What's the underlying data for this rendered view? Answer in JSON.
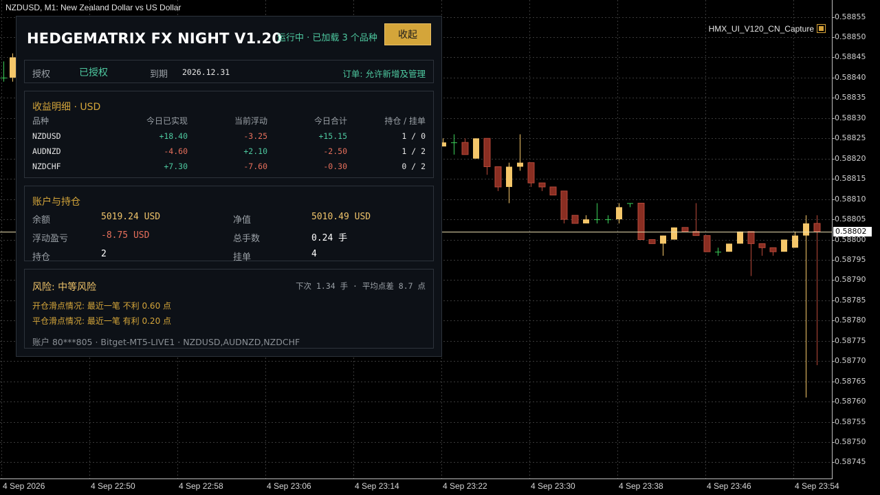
{
  "chart": {
    "title": "NZDUSD, M1:  New Zealand Dollar vs US Dollar",
    "capture_label": "HMX_UI_V120_CN_Capture",
    "current_price": "0.58802",
    "price_labels": [
      "0.58855",
      "0.58850",
      "0.58845",
      "0.58840",
      "0.58835",
      "0.58830",
      "0.58825",
      "0.58820",
      "0.58815",
      "0.58810",
      "0.58805",
      "0.58800",
      "0.58795",
      "0.58790",
      "0.58785",
      "0.58780",
      "0.58775",
      "0.58770",
      "0.58765",
      "0.58760",
      "0.58755",
      "0.58750",
      "0.58745"
    ],
    "time_labels": [
      "4 Sep 2026",
      "4 Sep 22:50",
      "4 Sep 22:58",
      "4 Sep 23:06",
      "4 Sep 23:14",
      "4 Sep 23:22",
      "4 Sep 23:30",
      "4 Sep 23:38",
      "4 Sep 23:46",
      "4 Sep 23:54"
    ],
    "colors": {
      "bull": "#f5c76a",
      "bear": "#8a2e22",
      "bear_wick": "#b8493a",
      "doji": "#3cd15a",
      "grid": "#3a3a3a",
      "current_line": "#e8dcb0"
    }
  },
  "chart_data": {
    "type": "candlestick",
    "ylim": [
      0.58741,
      0.58859
    ],
    "candles": [
      {
        "o": 0.5884,
        "h": 0.58844,
        "l": 0.58839,
        "c": 0.5884
      },
      {
        "o": 0.5884,
        "h": 0.58846,
        "l": 0.58839,
        "c": 0.58845
      },
      {
        "o": 0.58823,
        "h": 0.58825,
        "l": 0.58823,
        "c": 0.58824
      },
      {
        "o": 0.58824,
        "h": 0.58826,
        "l": 0.58821,
        "c": 0.58824
      },
      {
        "o": 0.58824,
        "h": 0.58825,
        "l": 0.58821,
        "c": 0.58821
      },
      {
        "o": 0.5882,
        "h": 0.58825,
        "l": 0.5882,
        "c": 0.58825
      },
      {
        "o": 0.58825,
        "h": 0.58825,
        "l": 0.58816,
        "c": 0.58818
      },
      {
        "o": 0.58818,
        "h": 0.58818,
        "l": 0.58812,
        "c": 0.58813
      },
      {
        "o": 0.58813,
        "h": 0.58819,
        "l": 0.58809,
        "c": 0.58818
      },
      {
        "o": 0.58818,
        "h": 0.58826,
        "l": 0.58817,
        "c": 0.58819
      },
      {
        "o": 0.58819,
        "h": 0.58819,
        "l": 0.58813,
        "c": 0.58814
      },
      {
        "o": 0.58814,
        "h": 0.58814,
        "l": 0.58812,
        "c": 0.58813
      },
      {
        "o": 0.58813,
        "h": 0.58813,
        "l": 0.58811,
        "c": 0.58811
      },
      {
        "o": 0.58812,
        "h": 0.58812,
        "l": 0.58804,
        "c": 0.58805
      },
      {
        "o": 0.58806,
        "h": 0.58806,
        "l": 0.58804,
        "c": 0.58804
      },
      {
        "o": 0.58804,
        "h": 0.58806,
        "l": 0.58804,
        "c": 0.58805
      },
      {
        "o": 0.58805,
        "h": 0.58809,
        "l": 0.58804,
        "c": 0.58805
      },
      {
        "o": 0.58805,
        "h": 0.58806,
        "l": 0.58804,
        "c": 0.58805
      },
      {
        "o": 0.58805,
        "h": 0.58809,
        "l": 0.58804,
        "c": 0.58808
      },
      {
        "o": 0.58809,
        "h": 0.58809,
        "l": 0.58808,
        "c": 0.58809
      },
      {
        "o": 0.58809,
        "h": 0.58809,
        "l": 0.588,
        "c": 0.588
      },
      {
        "o": 0.588,
        "h": 0.588,
        "l": 0.58799,
        "c": 0.58799
      },
      {
        "o": 0.58799,
        "h": 0.58801,
        "l": 0.58796,
        "c": 0.58801
      },
      {
        "o": 0.588,
        "h": 0.58803,
        "l": 0.588,
        "c": 0.58803
      },
      {
        "o": 0.58803,
        "h": 0.58803,
        "l": 0.58802,
        "c": 0.58802
      },
      {
        "o": 0.58802,
        "h": 0.58809,
        "l": 0.58801,
        "c": 0.58801
      },
      {
        "o": 0.58801,
        "h": 0.58801,
        "l": 0.58797,
        "c": 0.58797
      },
      {
        "o": 0.58797,
        "h": 0.58798,
        "l": 0.58796,
        "c": 0.58797
      },
      {
        "o": 0.58797,
        "h": 0.58799,
        "l": 0.58797,
        "c": 0.58799
      },
      {
        "o": 0.58799,
        "h": 0.58802,
        "l": 0.58799,
        "c": 0.58802
      },
      {
        "o": 0.58802,
        "h": 0.58802,
        "l": 0.58791,
        "c": 0.58799
      },
      {
        "o": 0.58799,
        "h": 0.58799,
        "l": 0.58796,
        "c": 0.58798
      },
      {
        "o": 0.58798,
        "h": 0.58798,
        "l": 0.58796,
        "c": 0.58797
      },
      {
        "o": 0.58797,
        "h": 0.588,
        "l": 0.58797,
        "c": 0.588
      },
      {
        "o": 0.58798,
        "h": 0.58802,
        "l": 0.58798,
        "c": 0.58801
      },
      {
        "o": 0.58801,
        "h": 0.58806,
        "l": 0.58761,
        "c": 0.58804
      },
      {
        "o": 0.58804,
        "h": 0.58806,
        "l": 0.58769,
        "c": 0.58802
      }
    ]
  },
  "panel": {
    "title": "HEDGEMATRIX FX NIGHT V1.20",
    "status": "运行中 · 已加载 3 个品种",
    "collapse_label": "收起",
    "license": {
      "label": "授权",
      "value": "已授权",
      "expiry_label": "到期",
      "expiry_value": "2026.12.31",
      "order_label": "订单: 允许新增及管理"
    },
    "pnl": {
      "title": "收益明细 · USD",
      "headers": [
        "品种",
        "今日已实现",
        "当前浮动",
        "今日合计",
        "持仓 / 挂单"
      ],
      "rows": [
        {
          "symbol": "NZDUSD",
          "realized": "+18.40",
          "floating": "-3.25",
          "total": "+15.15",
          "pos": "1 / 0"
        },
        {
          "symbol": "AUDNZD",
          "realized": "-4.60",
          "floating": "+2.10",
          "total": "-2.50",
          "pos": "1 / 2"
        },
        {
          "symbol": "NZDCHF",
          "realized": "+7.30",
          "floating": "-7.60",
          "total": "-0.30",
          "pos": "0 / 2"
        }
      ]
    },
    "account": {
      "title": "账户与持仓",
      "balance_label": "余额",
      "balance_value": "5019.24 USD",
      "equity_label": "净值",
      "equity_value": "5010.49 USD",
      "floating_label": "浮动盈亏",
      "floating_value": "-8.75 USD",
      "lots_label": "总手数",
      "lots_value": "0.24 手",
      "positions_label": "持仓",
      "positions_value": "2",
      "pending_label": "挂单",
      "pending_value": "4"
    },
    "risk": {
      "title": "风险: 中等风险",
      "next_info": "下次 1.34 手 · 平均点差 8.7 点",
      "open_slip": "开仓滑点情况: 最近一笔 不利 0.60 点",
      "close_slip": "平仓滑点情况: 最近一笔 有利 0.20 点",
      "footer": "账户 80***805  ·  Bitget-MT5-LIVE1  ·  NZDUSD,AUDNZD,NZDCHF"
    }
  }
}
